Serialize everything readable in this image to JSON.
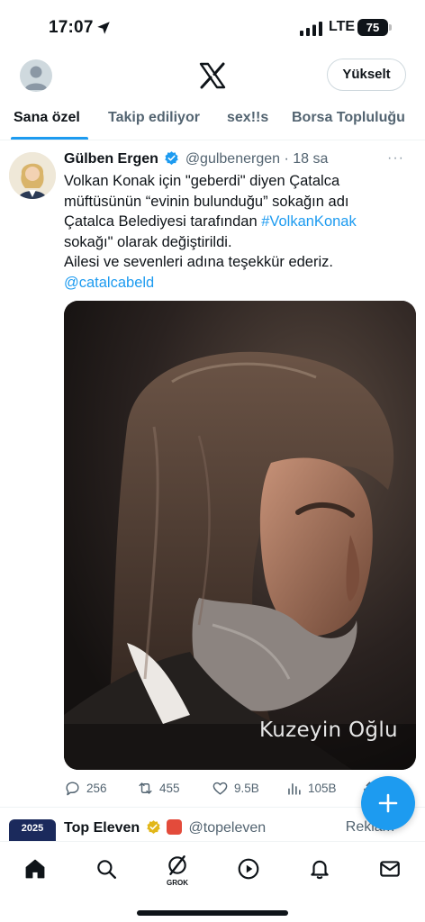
{
  "status_bar": {
    "time": "17:07",
    "network": "LTE",
    "battery": "75"
  },
  "header": {
    "logo": "x-logo",
    "upgrade_label": "Yükselt"
  },
  "tabs": [
    {
      "label": "Sana özel",
      "active": true
    },
    {
      "label": "Takip ediliyor",
      "active": false
    },
    {
      "label": "sex!!s",
      "active": false
    },
    {
      "label": "Borsa Topluluğu",
      "active": false
    }
  ],
  "tweet": {
    "author_name": "Gülben Ergen",
    "handle": "@gulbenergen",
    "separator": "·",
    "time": "18 sa",
    "more": "···",
    "text_lines": [
      "Volkan Konak için \"geberdi\" diyen Çatalca",
      "müftüsünün “evinin bulunduğu” sokağın adı",
      "Çatalca Belediyesi tarafından ",
      "sokağı\" olarak değiştirildi.",
      "Ailesi ve sevenleri adına teşekkür ederiz."
    ],
    "hashtag": "#VolkanKonak",
    "mention": "@catalcabeld",
    "media_caption": "Kuzeyin Oğlu",
    "stats": {
      "replies": "256",
      "reposts": "455",
      "likes": "9.5B",
      "views": "105B"
    }
  },
  "next_tweet": {
    "avatar_text": "2025",
    "author_name": "Top Eleven",
    "handle": "@topeleven",
    "ad_label": "Reklam"
  },
  "fab": {
    "icon": "plus-icon"
  },
  "bottom_nav": [
    {
      "name": "home",
      "icon": "home-icon"
    },
    {
      "name": "search",
      "icon": "search-icon"
    },
    {
      "name": "grok",
      "icon": "grok-icon",
      "label": "GROK"
    },
    {
      "name": "video",
      "icon": "play-icon"
    },
    {
      "name": "notifications",
      "icon": "bell-icon"
    },
    {
      "name": "messages",
      "icon": "mail-icon"
    }
  ],
  "colors": {
    "accent": "#1d9bf0",
    "text": "#0f1419",
    "secondary": "#536471"
  }
}
